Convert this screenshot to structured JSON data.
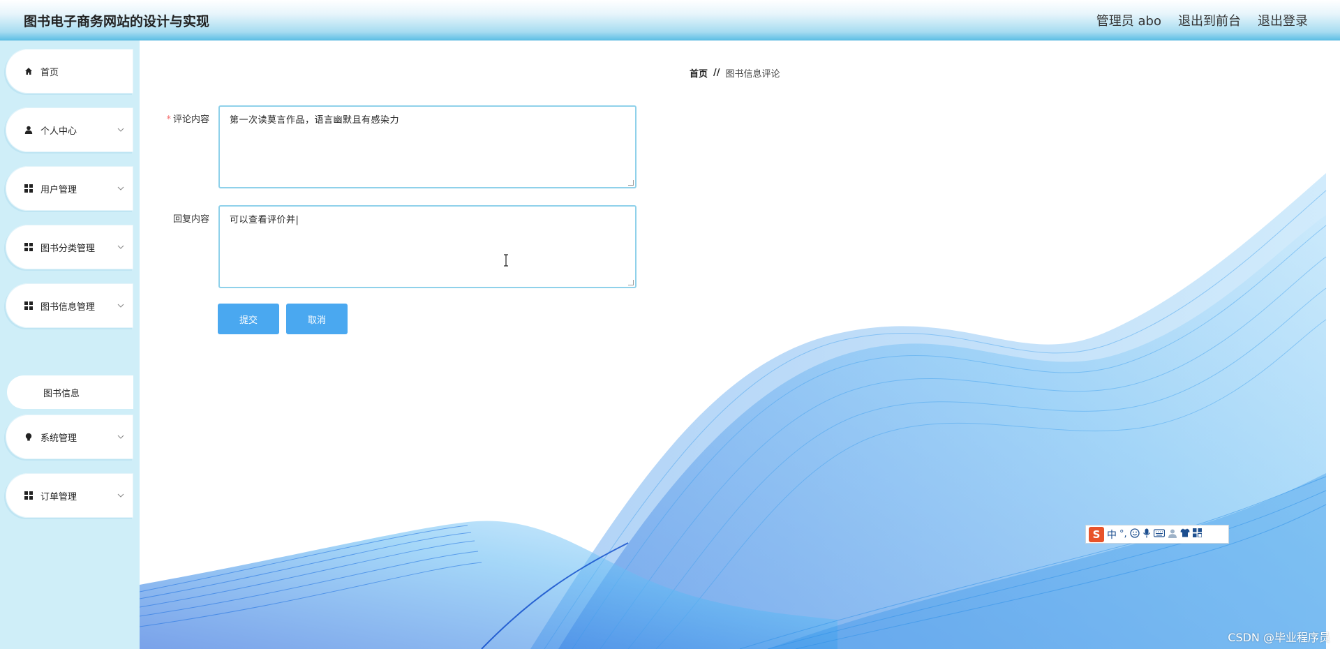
{
  "header": {
    "app_title": "图书电子商务网站的设计与实现",
    "links": [
      {
        "label": "管理员 abo"
      },
      {
        "label": "退出到前台"
      },
      {
        "label": "退出登录"
      }
    ]
  },
  "sidebar": {
    "items": [
      {
        "label": "首页",
        "icon": "home-icon",
        "has_chevron": false
      },
      {
        "label": "个人中心",
        "icon": "user-icon",
        "has_chevron": true
      },
      {
        "label": "用户管理",
        "icon": "grid-icon",
        "has_chevron": true
      },
      {
        "label": "图书分类管理",
        "icon": "grid-icon",
        "has_chevron": true
      },
      {
        "label": "图书信息管理",
        "icon": "grid-icon",
        "has_chevron": true
      },
      {
        "label": "系统管理",
        "icon": "bulb-icon",
        "has_chevron": true
      },
      {
        "label": "订单管理",
        "icon": "grid-icon",
        "has_chevron": true
      }
    ],
    "submenu": {
      "label": "图书信息"
    }
  },
  "breadcrumb": {
    "home": "首页",
    "separator": "//",
    "current": "图书信息评论"
  },
  "form": {
    "comment_label": "评论内容",
    "comment_required_mark": "*",
    "comment_value": "第一次读莫言作品，语言幽默且有感染力",
    "reply_label": "回复内容",
    "reply_value": "可以查看评价并|",
    "submit_label": "提交",
    "cancel_label": "取消"
  },
  "ime_toolbar": {
    "logo": "S",
    "mode": "中",
    "punct": "°,",
    "icons": [
      "smiley-icon",
      "microphone-icon",
      "keyboard-icon",
      "user-icon",
      "shirt-icon",
      "grid-icon"
    ]
  },
  "watermark": "CSDN @毕业程序员",
  "colors": {
    "topbar_accent": "#62c0e6",
    "sidebar_bg": "#cfeef8",
    "button_primary": "#4aa8f0",
    "input_border": "#8fd1ea",
    "wave_blue": "#2b8fe8"
  }
}
